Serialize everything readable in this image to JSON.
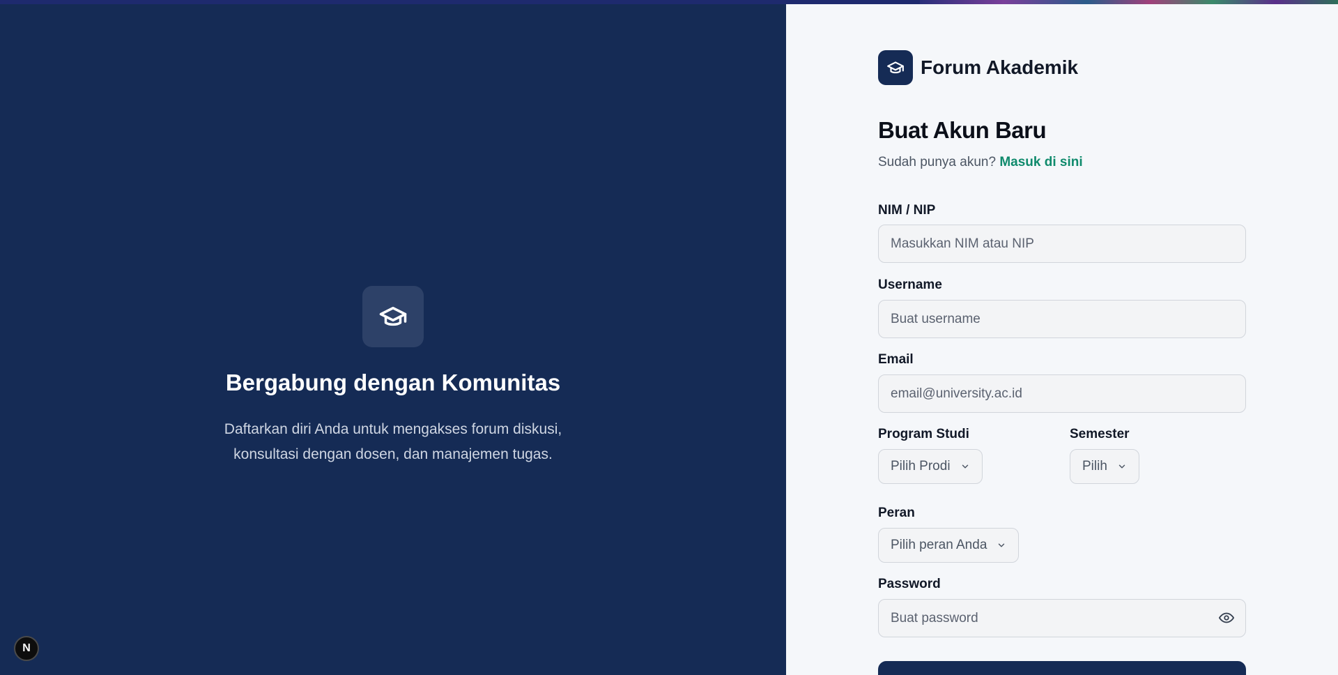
{
  "hero": {
    "title": "Bergabung dengan Komunitas",
    "subtitle_line1": "Daftarkan diri Anda untuk mengakses forum diskusi,",
    "subtitle_line2": "konsultasi dengan dosen, dan manajemen tugas.",
    "icon": "graduation-cap-icon"
  },
  "brand": {
    "name": "Forum Akademik",
    "icon": "graduation-cap-icon"
  },
  "form": {
    "title": "Buat Akun Baru",
    "signin_prompt": "Sudah punya akun?",
    "signin_link": "Masuk di sini",
    "nim_label": "NIM / NIP",
    "nim_placeholder": "Masukkan NIM atau NIP",
    "username_label": "Username",
    "username_placeholder": "Buat username",
    "email_label": "Email",
    "email_placeholder": "email@university.ac.id",
    "prodi_label": "Program Studi",
    "prodi_value": "Pilih Prodi",
    "semester_label": "Semester",
    "semester_value": "Pilih",
    "role_label": "Peran",
    "role_value": "Pilih peran Anda",
    "password_label": "Password",
    "password_placeholder": "Buat password"
  },
  "badge": {
    "letter": "N"
  },
  "colors": {
    "navy": "#152b55",
    "accent_green": "#0f8a6c",
    "panel_bg": "#f5f7fa"
  }
}
